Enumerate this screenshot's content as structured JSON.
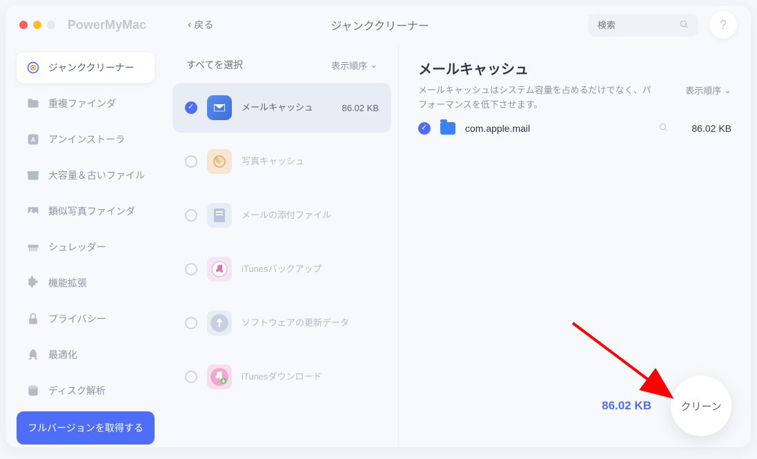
{
  "app": {
    "name": "PowerMyMac",
    "back": "戻る",
    "title": "ジャンククリーナー"
  },
  "search": {
    "placeholder": "検索"
  },
  "help": {
    "label": "?"
  },
  "sidebar": {
    "items": [
      {
        "label": "ジャンククリーナー"
      },
      {
        "label": "重複ファインダ"
      },
      {
        "label": "アンインストーラ"
      },
      {
        "label": "大容量＆古いファイル"
      },
      {
        "label": "類似写真ファインダ"
      },
      {
        "label": "シュレッダー"
      },
      {
        "label": "機能拡張"
      },
      {
        "label": "プライバシー"
      },
      {
        "label": "最適化"
      },
      {
        "label": "ディスク解析"
      }
    ],
    "full_version": "フルバージョンを取得する"
  },
  "col2": {
    "select_all": "すべてを選択",
    "sort": "表示順序",
    "categories": [
      {
        "label": "メールキャッシュ",
        "size": "86.02 KB",
        "checked": true,
        "icon": "mail"
      },
      {
        "label": "写真キャッシュ",
        "size": "",
        "checked": false,
        "icon": "photo"
      },
      {
        "label": "メールの添付ファイル",
        "size": "",
        "checked": false,
        "icon": "attach"
      },
      {
        "label": "iTunesバックアップ",
        "size": "",
        "checked": false,
        "icon": "itunes"
      },
      {
        "label": "ソフトウェアの更新データ",
        "size": "",
        "checked": false,
        "icon": "update"
      },
      {
        "label": "iTunesダウンロード",
        "size": "",
        "checked": false,
        "icon": "download"
      }
    ]
  },
  "detail": {
    "title": "メールキャッシュ",
    "desc": "メールキャッシュはシステム容量を占めるだけでなく、パフォーマンスを低下させます。",
    "sort": "表示順序",
    "files": [
      {
        "name": "com.apple.mail",
        "size": "86.02 KB",
        "checked": true
      }
    ]
  },
  "footer": {
    "total": "86.02 KB",
    "clean": "クリーン"
  }
}
